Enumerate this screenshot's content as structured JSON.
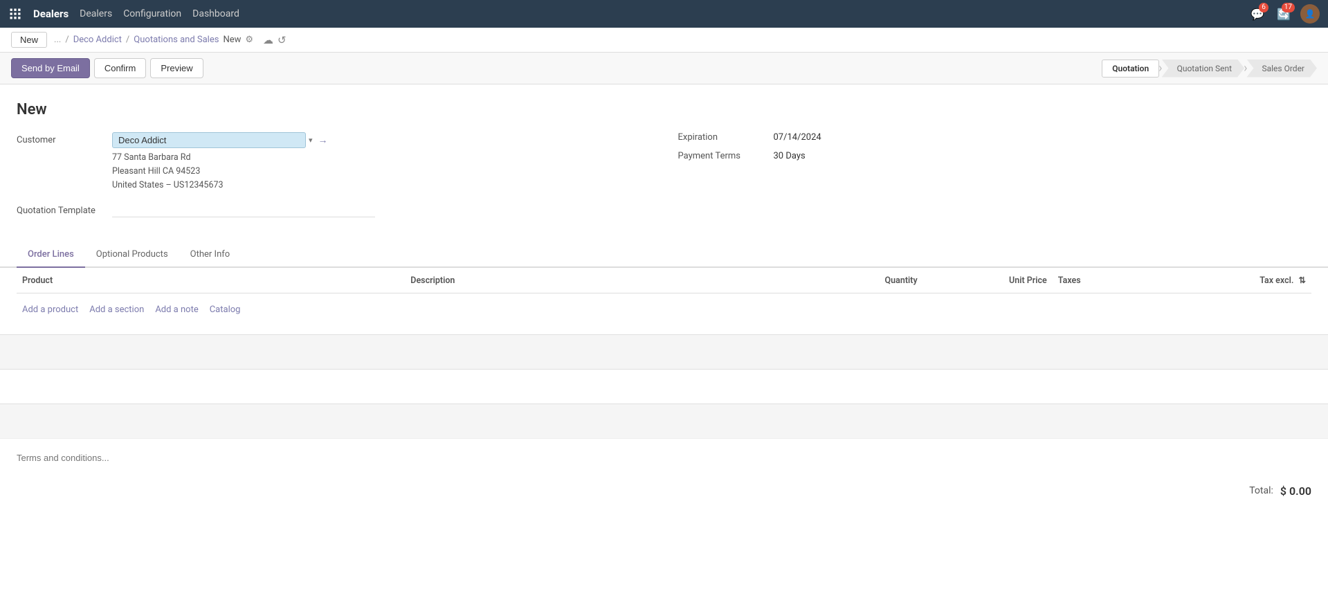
{
  "topnav": {
    "brand": "Dealers",
    "menu_items": [
      "Dealers",
      "Configuration",
      "Dashboard"
    ],
    "chat_badge": "6",
    "activity_badge": "17"
  },
  "breadcrumb": {
    "new_label": "New",
    "ellipsis": "...",
    "parent1": "Deco Addict",
    "parent2": "Quotations and Sales",
    "current": "New"
  },
  "actions": {
    "send_email": "Send by Email",
    "confirm": "Confirm",
    "preview": "Preview"
  },
  "pipeline": {
    "steps": [
      "Quotation",
      "Quotation Sent",
      "Sales Order"
    ],
    "active": "Quotation"
  },
  "form": {
    "title": "New",
    "customer_label": "Customer",
    "customer_value": "Deco Addict",
    "address_line1": "77 Santa Barbara Rd",
    "address_line2": "Pleasant Hill CA 94523",
    "address_line3": "United States – US12345673",
    "quotation_template_label": "Quotation Template",
    "expiration_label": "Expiration",
    "expiration_value": "07/14/2024",
    "payment_terms_label": "Payment Terms",
    "payment_terms_value": "30 Days"
  },
  "tabs": {
    "items": [
      "Order Lines",
      "Optional Products",
      "Other Info"
    ],
    "active": "Order Lines"
  },
  "table": {
    "columns": [
      "Product",
      "Description",
      "Quantity",
      "Unit Price",
      "Taxes",
      "Tax excl."
    ],
    "add_links": [
      "Add a product",
      "Add a section",
      "Add a note",
      "Catalog"
    ]
  },
  "footer": {
    "terms_placeholder": "Terms and conditions...",
    "total_label": "Total:",
    "total_value": "$ 0.00"
  }
}
